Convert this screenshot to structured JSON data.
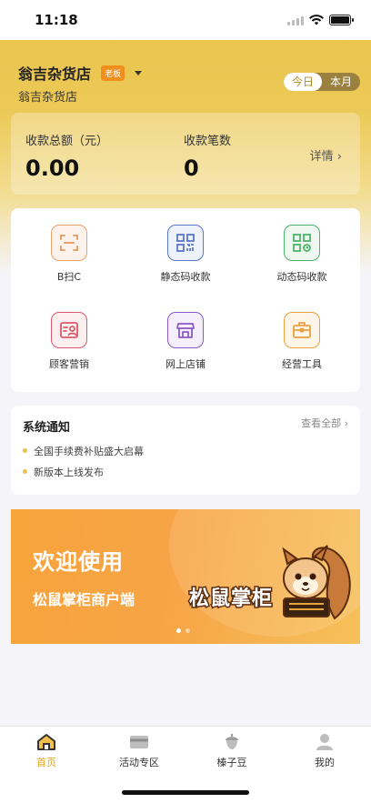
{
  "status_bar": {
    "time": "11:18"
  },
  "store": {
    "name": "翁吉杂货店",
    "role_badge": "老板",
    "subtitle": "翁吉杂货店"
  },
  "period_toggle": {
    "options": [
      "今日",
      "本月"
    ],
    "selected": "今日"
  },
  "stats": {
    "total_amount_label": "收款总额（元）",
    "total_amount_value": "0.00",
    "count_label": "收款笔数",
    "count_value": "0",
    "details_label": "详情 ›"
  },
  "services": [
    {
      "label": "B扫C",
      "icon": "scan-frame-icon",
      "color": "#e9a06a"
    },
    {
      "label": "静态码收款",
      "icon": "qr-code-icon",
      "color": "#5a78c8"
    },
    {
      "label": "动态码收款",
      "icon": "dynamic-qr-icon",
      "color": "#4eb36a"
    },
    {
      "label": "顾客营销",
      "icon": "customer-icon",
      "color": "#d95a6a"
    },
    {
      "label": "网上店铺",
      "icon": "storefront-icon",
      "color": "#8a5ac8"
    },
    {
      "label": "经营工具",
      "icon": "toolbox-icon",
      "color": "#e9a240"
    }
  ],
  "notices": {
    "title": "系统通知",
    "view_all": "查看全部 ›",
    "items": [
      "全国手续费补贴盛大启幕",
      "新版本上线发布"
    ]
  },
  "banner": {
    "title": "欢迎使用",
    "subtitle": "松鼠掌柜商户端",
    "brand": "松鼠掌柜",
    "page_count": 2,
    "active_page": 1
  },
  "tabbar": {
    "tabs": [
      {
        "label": "首页",
        "icon": "home-icon",
        "active": true
      },
      {
        "label": "活动专区",
        "icon": "card-icon",
        "active": false
      },
      {
        "label": "榛子豆",
        "icon": "acorn-icon",
        "active": false
      },
      {
        "label": "我的",
        "icon": "person-icon",
        "active": false
      }
    ]
  },
  "colors": {
    "accent": "#e8c24a",
    "active_tab": "#e3a21a",
    "badge": "#f08f1e"
  }
}
